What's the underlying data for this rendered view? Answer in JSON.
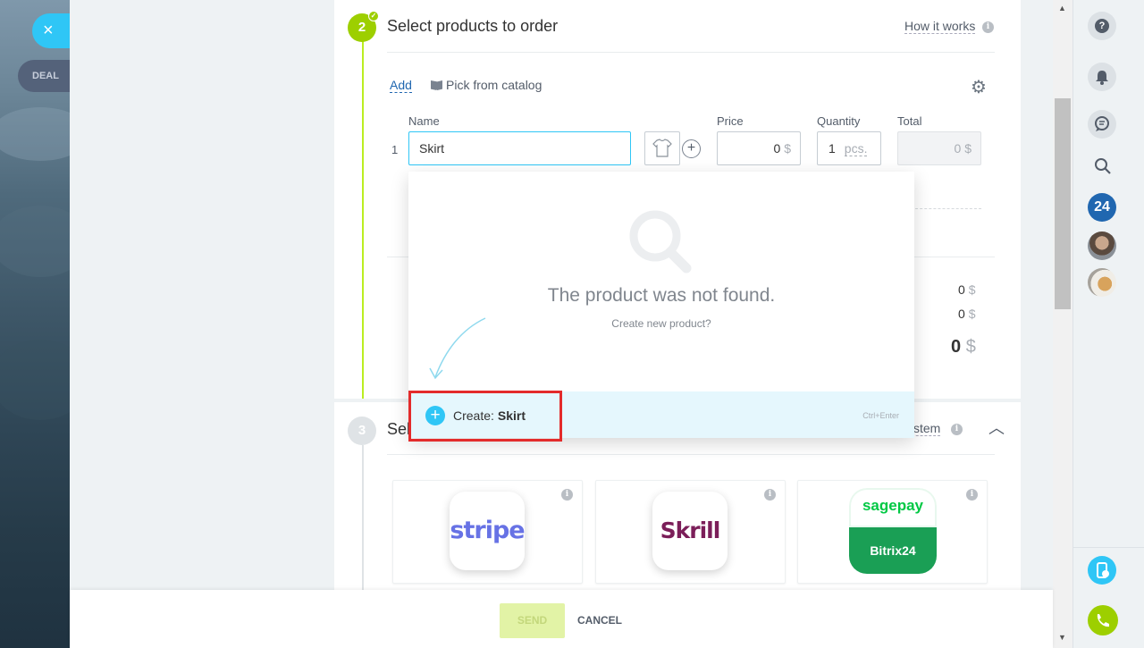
{
  "slider": {
    "close_icon": "×",
    "entity_label": "DEAL"
  },
  "step2": {
    "number": "2",
    "title": "Select products to order",
    "how_it_works": "How it works",
    "add_label": "Add",
    "catalog_label": "Pick from catalog",
    "columns": {
      "name": "Name",
      "price": "Price",
      "quantity": "Quantity",
      "total": "Total"
    },
    "row": {
      "index": "1",
      "name": "Skirt",
      "price_value": "0",
      "price_currency": "$",
      "quantity_value": "1",
      "quantity_unit": "pcs.",
      "total_value": "0",
      "total_currency": "$"
    },
    "summary": [
      {
        "value": "0",
        "currency": "$"
      },
      {
        "value": "0",
        "currency": "$"
      },
      {
        "value": "0",
        "currency": "$"
      }
    ]
  },
  "dropdown": {
    "not_found_title": "The product was not found.",
    "create_new_prompt": "Create new product?",
    "create_label": "Create:",
    "create_value": "Skirt",
    "shortcut": "Ctrl+Enter"
  },
  "step3": {
    "number": "3",
    "title_visible": "Sel",
    "payment_system_label": "ystem",
    "providers": [
      {
        "name": "stripe",
        "logo_text": "stripe"
      },
      {
        "name": "Skrill",
        "logo_text": "Skrill"
      },
      {
        "name": "sagepay Bitrix24",
        "logo_top": "sagepay",
        "logo_bottom": "Bitrix24"
      }
    ]
  },
  "footer": {
    "send_label": "SEND",
    "cancel_label": "CANCEL"
  },
  "right_sidebar": {
    "help_icon": "?",
    "bitrix_badge": "24"
  },
  "colors": {
    "accent_blue": "#2fc6f6",
    "step_green": "#9dcf00",
    "link_blue": "#2067b0",
    "highlight_red": "#e32b2b"
  }
}
